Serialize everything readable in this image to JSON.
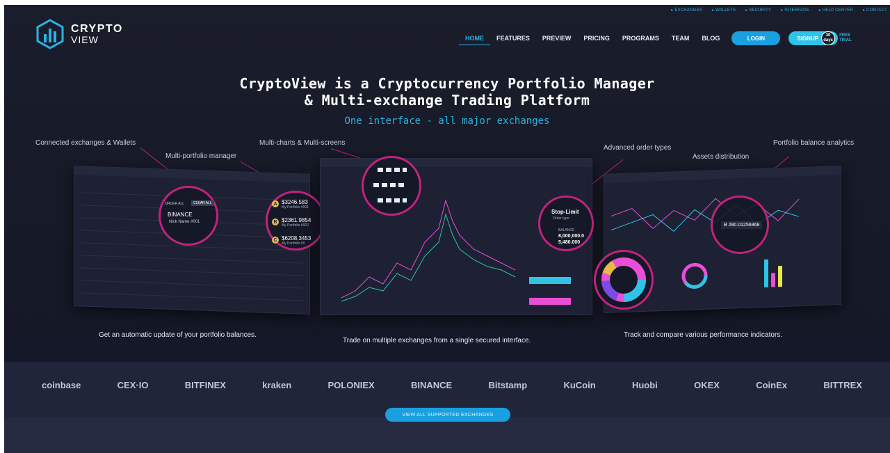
{
  "utility_links": [
    "EXCHANGES",
    "WALLETS",
    "SECURITY",
    "INTERFACE",
    "HELP CENTER",
    "CONTACT"
  ],
  "logo": {
    "line1": "CRYPTO",
    "line2": "VIEW"
  },
  "nav": {
    "items": [
      "HOME",
      "FEATURES",
      "PREVIEW",
      "PRICING",
      "PROGRAMS",
      "TEAM",
      "BLOG"
    ],
    "login": "LOGIN",
    "signup": "SIGNUP",
    "trial_days": "30",
    "trial_unit": "days",
    "trial_text1": "FREE",
    "trial_text2": "TRIAL"
  },
  "hero": {
    "headline1": "CryptoView is a Cryptocurrency Portfolio Manager",
    "headline2": "& Multi-exchange Trading Platform",
    "subline": "One interface - all major exchanges"
  },
  "callouts": {
    "connected": "Connected exchanges & Wallets",
    "multiportfolio": "Multi-portfolio manager",
    "multicharts": "Multi-charts & Multi-screens",
    "advanced": "Advanced order types",
    "assets": "Assets distribution",
    "analytics": "Portfolio balance analytics"
  },
  "rings": {
    "order_all": "ORDER ALL",
    "clear_all": "CLEAR ALL",
    "binance": "BINANCE",
    "nickname": "Nick Name #001",
    "portfolio_a_value": "$3246.583",
    "portfolio_a_name": "My Portfolio #001",
    "portfolio_b_value": "$2361.9854",
    "portfolio_b_name": "My Portfolio #002",
    "portfolio_c_value": "$6208.3453",
    "portfolio_c_name": "My Portfolio #0",
    "stop_limit": "Stop-Limit",
    "order_type": "Order type",
    "balance_label": "BALANCE",
    "balance_1": "8,000,000.0",
    "balance_2": "5,480.000",
    "btc_value": "B 280.01256868"
  },
  "descriptions": {
    "left": "Get an automatic update of your portfolio balances.",
    "middle": "Trade on multiple exchanges from a single secured interface.",
    "right": "Track and compare various performance indicators."
  },
  "exchanges": [
    "coinbase",
    "CEX·IO",
    "BITFINEX",
    "kraken",
    "POLONIEX",
    "BINANCE",
    "Bitstamp",
    "KuCoin",
    "Huobi",
    "OKEX",
    "CoinEx",
    "BITTREX"
  ],
  "cta": "VIEW ALL SUPPORTED EXCHANGES",
  "colors": {
    "accent": "#2ab3e6",
    "ring": "#c1227f",
    "bg": "#1a1d2b"
  }
}
